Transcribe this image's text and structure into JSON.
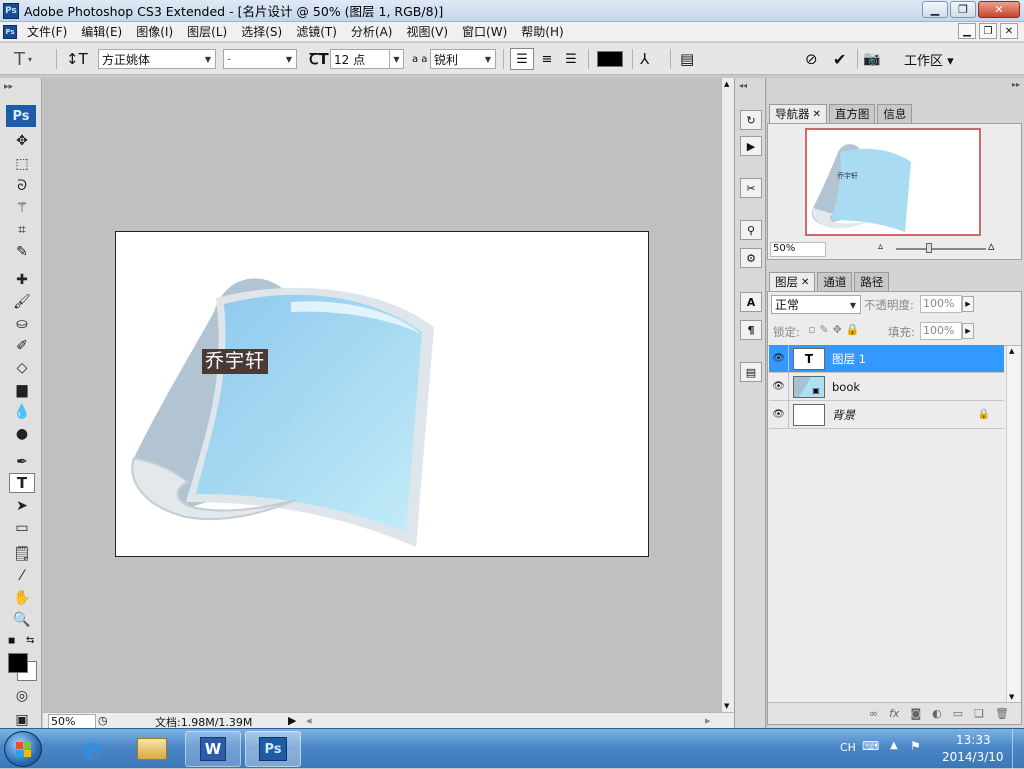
{
  "window": {
    "title": "Adobe Photoshop CS3 Extended - [名片设计 @ 50% (图层 1, RGB/8)]",
    "ps_badge": "Ps"
  },
  "menu": [
    "文件(F)",
    "编辑(E)",
    "图像(I)",
    "图层(L)",
    "选择(S)",
    "滤镜(T)",
    "分析(A)",
    "视图(V)",
    "窗口(W)",
    "帮助(H)"
  ],
  "options": {
    "font_family": "方正姚体",
    "font_style": "-",
    "font_size": "12 点",
    "aa_label": "a a",
    "antialias": "锐利",
    "workspace": "工作区 ▾"
  },
  "toolbox": {
    "logo": "Ps"
  },
  "canvas": {
    "text_layer_content": "乔宇轩"
  },
  "status": {
    "zoom": "50%",
    "doc_info": "文档:1.98M/1.39M"
  },
  "navigator": {
    "tabs": [
      "导航器",
      "直方图",
      "信息"
    ],
    "zoom": "50%"
  },
  "layers_panel": {
    "tabs": [
      "图层",
      "通道",
      "路径"
    ],
    "blend_mode": "正常",
    "opacity_label": "不透明度:",
    "opacity": "100%",
    "lock_label": "锁定:",
    "fill_label": "填充:",
    "fill": "100%",
    "layers": [
      {
        "name": "图层 1",
        "thumb": "T"
      },
      {
        "name": "book",
        "thumb": ""
      },
      {
        "name": "背景",
        "thumb": ""
      }
    ]
  },
  "taskbar": {
    "lang": "CH",
    "time": "13:33",
    "date": "2014/3/10",
    "ps_label": "Ps"
  },
  "colors": {
    "selection": "#3399ff",
    "canvas_bg": "#c0c0c0",
    "ps_blue": "#1e5ca8"
  }
}
